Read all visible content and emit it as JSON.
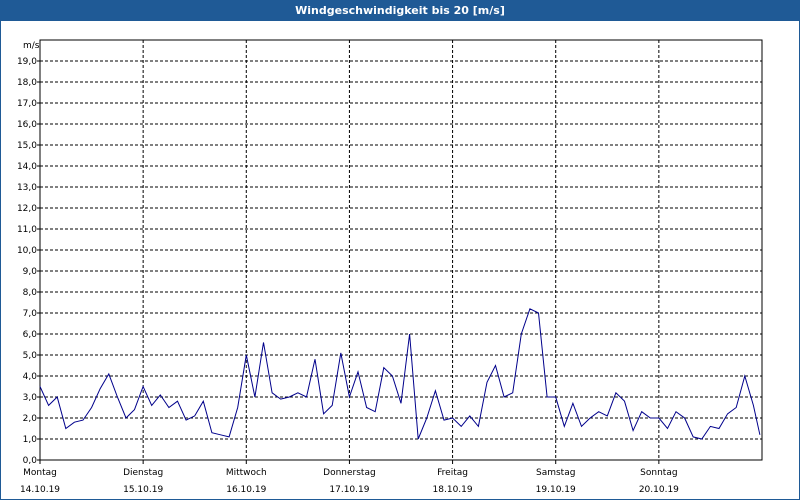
{
  "window": {
    "title": "Windgeschwindigkeit bis 20 [m/s]"
  },
  "colors": {
    "titlebar": "#1f5a96",
    "line": "#00008b",
    "grid": "#000000"
  },
  "chart_data": {
    "type": "line",
    "title": "Windgeschwindigkeit bis 20 [m/s]",
    "ylabel": "m/s",
    "ylim": [
      0,
      20
    ],
    "yticks": [
      "0,0",
      "1,0",
      "2,0",
      "3,0",
      "4,0",
      "5,0",
      "6,0",
      "7,0",
      "8,0",
      "9,0",
      "10,0",
      "11,0",
      "12,0",
      "13,0",
      "14,0",
      "15,0",
      "16,0",
      "17,0",
      "18,0",
      "19,0"
    ],
    "xlim": [
      "14.10.19 00:00",
      "21.10.19 00:00"
    ],
    "days": [
      {
        "weekday": "Montag",
        "date": "14.10.19"
      },
      {
        "weekday": "Dienstag",
        "date": "15.10.19"
      },
      {
        "weekday": "Mittwoch",
        "date": "16.10.19"
      },
      {
        "weekday": "Donnerstag",
        "date": "17.10.19"
      },
      {
        "weekday": "Freitag",
        "date": "18.10.19"
      },
      {
        "weekday": "Samstag",
        "date": "19.10.19"
      },
      {
        "weekday": "Sonntag",
        "date": "20.10.19"
      }
    ],
    "grid": true,
    "series": [
      {
        "x": [
          "14.10.19 00:00",
          "14.10.19 02:00",
          "14.10.19 04:00",
          "14.10.19 06:00",
          "14.10.19 08:00",
          "14.10.19 10:00",
          "14.10.19 12:00",
          "14.10.19 14:00",
          "14.10.19 16:00",
          "14.10.19 18:00",
          "14.10.19 20:00",
          "14.10.19 22:00",
          "15.10.19 00:00",
          "15.10.19 02:00",
          "15.10.19 04:00",
          "15.10.19 06:00",
          "15.10.19 08:00",
          "15.10.19 10:00",
          "15.10.19 12:00",
          "15.10.19 14:00",
          "15.10.19 16:00",
          "15.10.19 18:00",
          "15.10.19 20:00",
          "15.10.19 22:00",
          "16.10.19 00:00",
          "16.10.19 02:00",
          "16.10.19 04:00",
          "16.10.19 06:00",
          "16.10.19 08:00",
          "16.10.19 10:00",
          "16.10.19 12:00",
          "16.10.19 14:00",
          "16.10.19 16:00",
          "16.10.19 18:00",
          "16.10.19 20:00",
          "16.10.19 22:00",
          "17.10.19 00:00",
          "17.10.19 02:00",
          "17.10.19 04:00",
          "17.10.19 06:00",
          "17.10.19 08:00",
          "17.10.19 10:00",
          "17.10.19 12:00",
          "17.10.19 14:00",
          "17.10.19 16:00",
          "17.10.19 18:00",
          "17.10.19 20:00",
          "17.10.19 22:00",
          "18.10.19 00:00",
          "18.10.19 02:00",
          "18.10.19 04:00",
          "18.10.19 06:00",
          "18.10.19 08:00",
          "18.10.19 10:00",
          "18.10.19 12:00",
          "18.10.19 14:00",
          "18.10.19 16:00",
          "18.10.19 18:00",
          "18.10.19 20:00",
          "18.10.19 22:00",
          "19.10.19 00:00",
          "19.10.19 02:00",
          "19.10.19 04:00",
          "19.10.19 06:00",
          "19.10.19 08:00",
          "19.10.19 10:00",
          "19.10.19 12:00",
          "19.10.19 14:00",
          "19.10.19 16:00",
          "19.10.19 18:00",
          "19.10.19 20:00",
          "19.10.19 22:00",
          "20.10.19 00:00",
          "20.10.19 02:00",
          "20.10.19 04:00",
          "20.10.19 06:00",
          "20.10.19 08:00",
          "20.10.19 10:00",
          "20.10.19 12:00",
          "20.10.19 14:00",
          "20.10.19 16:00",
          "20.10.19 18:00",
          "20.10.19 20:00",
          "20.10.19 22:00",
          "20.10.19 23:30"
        ],
        "values": [
          3.5,
          2.6,
          3.0,
          1.5,
          1.8,
          1.9,
          2.5,
          3.4,
          4.1,
          3.0,
          2.0,
          2.4,
          3.5,
          2.6,
          3.1,
          2.5,
          2.8,
          1.9,
          2.1,
          2.8,
          1.3,
          1.2,
          1.1,
          2.5,
          5.0,
          3.0,
          5.6,
          3.2,
          2.9,
          3.0,
          3.2,
          3.0,
          4.8,
          2.2,
          2.6,
          5.1,
          3.0,
          4.2,
          2.5,
          2.3,
          4.4,
          4.0,
          2.7,
          6.0,
          1.0,
          2.0,
          3.3,
          1.9,
          2.0,
          1.6,
          2.1,
          1.6,
          3.7,
          4.5,
          3.0,
          3.2,
          6.0,
          7.2,
          7.0,
          3.0,
          3.0,
          1.6,
          2.7,
          1.6,
          2.0,
          2.3,
          2.1,
          3.2,
          2.8,
          1.4,
          2.3,
          2.0,
          2.0,
          1.5,
          2.3,
          2.0,
          1.1,
          1.0,
          1.6,
          1.5,
          2.2,
          2.5,
          4.0,
          2.6,
          1.2
        ]
      }
    ]
  }
}
